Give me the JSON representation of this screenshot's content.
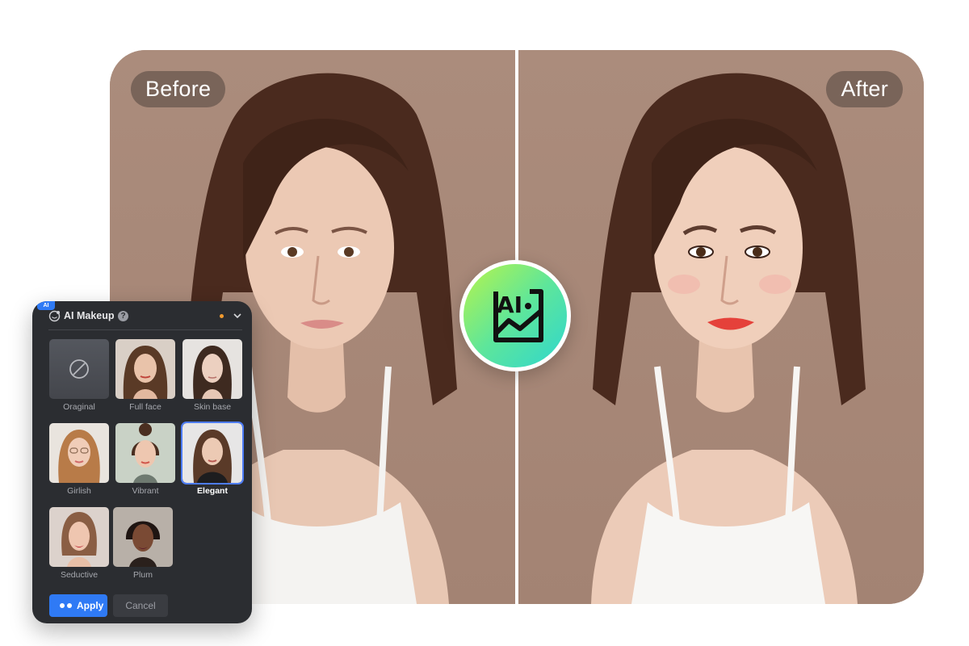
{
  "comparison": {
    "before_label": "Before",
    "after_label": "After"
  },
  "badge": {
    "label": "AI",
    "icon": "ai-image-icon"
  },
  "panel": {
    "badge": "AI",
    "title": "AI Makeup",
    "help_symbol": "?",
    "selected_style": "Elegant",
    "styles": [
      {
        "label": "Oraginal"
      },
      {
        "label": "Full face"
      },
      {
        "label": "Skin base"
      },
      {
        "label": "Girlish"
      },
      {
        "label": "Vibrant"
      },
      {
        "label": "Elegant"
      },
      {
        "label": "Seductive"
      },
      {
        "label": "Plum"
      }
    ],
    "apply_label": "Apply",
    "cancel_label": "Cancel"
  },
  "colors": {
    "backdrop": "#a98a7a",
    "panel_bg": "#2b2d31",
    "accent": "#2f7af5",
    "badge_gradient_start": "#b9f44a",
    "badge_gradient_end": "#2fd6cf"
  }
}
